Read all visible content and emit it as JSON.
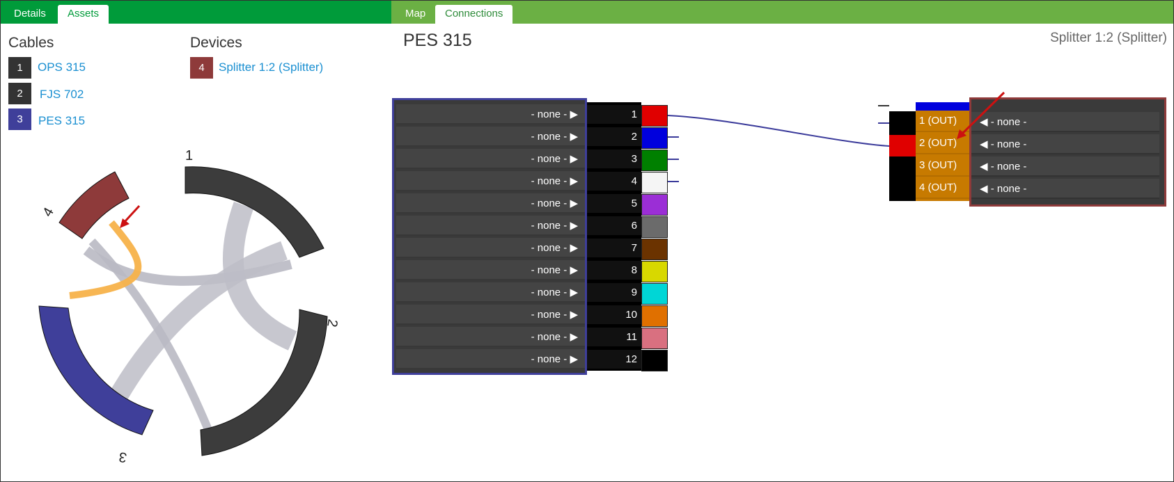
{
  "tabs_left": [
    {
      "label": "Details",
      "active": false
    },
    {
      "label": "Assets",
      "active": true
    }
  ],
  "tabs_right": [
    {
      "label": "Map",
      "active": false
    },
    {
      "label": "Connections",
      "active": true
    }
  ],
  "legend": {
    "cables_title": "Cables",
    "devices_title": "Devices",
    "cables": [
      {
        "num": "1",
        "name": "OPS 315",
        "color": "#333333"
      },
      {
        "num": "2",
        "name": "FJS 702",
        "color": "#333333"
      },
      {
        "num": "3",
        "name": "PES 315",
        "color": "#3f3f9a"
      }
    ],
    "devices": [
      {
        "num": "4",
        "name": "Splitter 1:2 (Splitter)",
        "color": "#8e3a3a"
      }
    ]
  },
  "chord": {
    "labels": [
      "1",
      "2",
      "3",
      "4"
    ]
  },
  "connections": {
    "title": "PES 315",
    "device_title": "Splitter 1:2 (Splitter)",
    "fiber_target_label": "- none - ▶",
    "fibers": [
      {
        "num": "1",
        "color": "#e00000"
      },
      {
        "num": "2",
        "color": "#0000dd"
      },
      {
        "num": "3",
        "color": "#008000"
      },
      {
        "num": "4",
        "color": "#f5f5f5"
      },
      {
        "num": "5",
        "color": "#9b2ed6"
      },
      {
        "num": "6",
        "color": "#6b6b6b"
      },
      {
        "num": "7",
        "color": "#6b3300"
      },
      {
        "num": "8",
        "color": "#d8d800"
      },
      {
        "num": "9",
        "color": "#00d6d6"
      },
      {
        "num": "10",
        "color": "#e07000"
      },
      {
        "num": "11",
        "color": "#d97080"
      },
      {
        "num": "12",
        "color": "#000000"
      }
    ],
    "splitter_ports": [
      {
        "label": "1 (OUT)",
        "target": "◀ - none -"
      },
      {
        "label": "2 (OUT)",
        "target": "◀ - none -"
      },
      {
        "label": "3 (OUT)",
        "target": "◀ - none -"
      },
      {
        "label": "4 (OUT)",
        "target": "◀ - none -"
      }
    ]
  },
  "colors": {
    "green_dark": "#009b3a",
    "green_light": "#6bb044",
    "link": "#1a8fd1",
    "highlight": "#f7b24a",
    "arrow": "#cc1111"
  }
}
